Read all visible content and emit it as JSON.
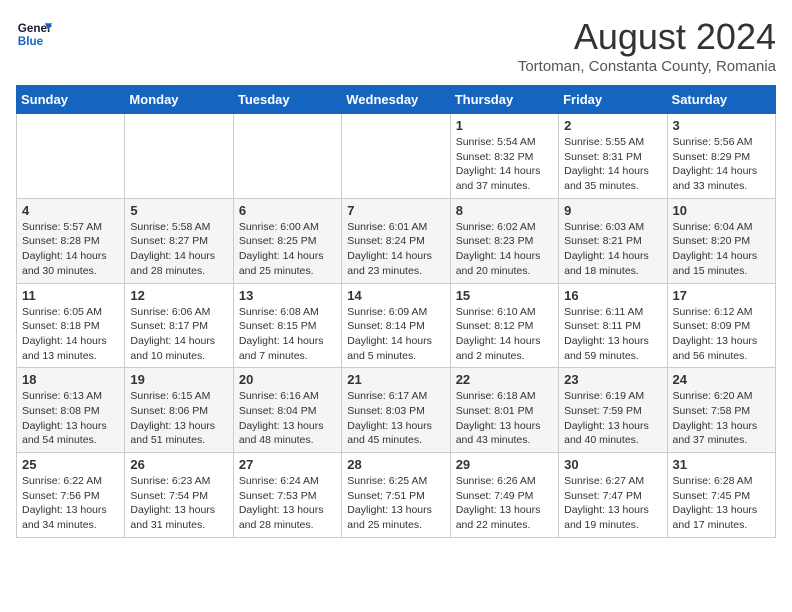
{
  "logo": {
    "line1": "General",
    "line2": "Blue"
  },
  "title": "August 2024",
  "subtitle": "Tortoman, Constanta County, Romania",
  "days_header": [
    "Sunday",
    "Monday",
    "Tuesday",
    "Wednesday",
    "Thursday",
    "Friday",
    "Saturday"
  ],
  "weeks": [
    [
      {
        "date": "",
        "detail": ""
      },
      {
        "date": "",
        "detail": ""
      },
      {
        "date": "",
        "detail": ""
      },
      {
        "date": "",
        "detail": ""
      },
      {
        "date": "1",
        "detail": "Sunrise: 5:54 AM\nSunset: 8:32 PM\nDaylight: 14 hours\nand 37 minutes."
      },
      {
        "date": "2",
        "detail": "Sunrise: 5:55 AM\nSunset: 8:31 PM\nDaylight: 14 hours\nand 35 minutes."
      },
      {
        "date": "3",
        "detail": "Sunrise: 5:56 AM\nSunset: 8:29 PM\nDaylight: 14 hours\nand 33 minutes."
      }
    ],
    [
      {
        "date": "4",
        "detail": "Sunrise: 5:57 AM\nSunset: 8:28 PM\nDaylight: 14 hours\nand 30 minutes."
      },
      {
        "date": "5",
        "detail": "Sunrise: 5:58 AM\nSunset: 8:27 PM\nDaylight: 14 hours\nand 28 minutes."
      },
      {
        "date": "6",
        "detail": "Sunrise: 6:00 AM\nSunset: 8:25 PM\nDaylight: 14 hours\nand 25 minutes."
      },
      {
        "date": "7",
        "detail": "Sunrise: 6:01 AM\nSunset: 8:24 PM\nDaylight: 14 hours\nand 23 minutes."
      },
      {
        "date": "8",
        "detail": "Sunrise: 6:02 AM\nSunset: 8:23 PM\nDaylight: 14 hours\nand 20 minutes."
      },
      {
        "date": "9",
        "detail": "Sunrise: 6:03 AM\nSunset: 8:21 PM\nDaylight: 14 hours\nand 18 minutes."
      },
      {
        "date": "10",
        "detail": "Sunrise: 6:04 AM\nSunset: 8:20 PM\nDaylight: 14 hours\nand 15 minutes."
      }
    ],
    [
      {
        "date": "11",
        "detail": "Sunrise: 6:05 AM\nSunset: 8:18 PM\nDaylight: 14 hours\nand 13 minutes."
      },
      {
        "date": "12",
        "detail": "Sunrise: 6:06 AM\nSunset: 8:17 PM\nDaylight: 14 hours\nand 10 minutes."
      },
      {
        "date": "13",
        "detail": "Sunrise: 6:08 AM\nSunset: 8:15 PM\nDaylight: 14 hours\nand 7 minutes."
      },
      {
        "date": "14",
        "detail": "Sunrise: 6:09 AM\nSunset: 8:14 PM\nDaylight: 14 hours\nand 5 minutes."
      },
      {
        "date": "15",
        "detail": "Sunrise: 6:10 AM\nSunset: 8:12 PM\nDaylight: 14 hours\nand 2 minutes."
      },
      {
        "date": "16",
        "detail": "Sunrise: 6:11 AM\nSunset: 8:11 PM\nDaylight: 13 hours\nand 59 minutes."
      },
      {
        "date": "17",
        "detail": "Sunrise: 6:12 AM\nSunset: 8:09 PM\nDaylight: 13 hours\nand 56 minutes."
      }
    ],
    [
      {
        "date": "18",
        "detail": "Sunrise: 6:13 AM\nSunset: 8:08 PM\nDaylight: 13 hours\nand 54 minutes."
      },
      {
        "date": "19",
        "detail": "Sunrise: 6:15 AM\nSunset: 8:06 PM\nDaylight: 13 hours\nand 51 minutes."
      },
      {
        "date": "20",
        "detail": "Sunrise: 6:16 AM\nSunset: 8:04 PM\nDaylight: 13 hours\nand 48 minutes."
      },
      {
        "date": "21",
        "detail": "Sunrise: 6:17 AM\nSunset: 8:03 PM\nDaylight: 13 hours\nand 45 minutes."
      },
      {
        "date": "22",
        "detail": "Sunrise: 6:18 AM\nSunset: 8:01 PM\nDaylight: 13 hours\nand 43 minutes."
      },
      {
        "date": "23",
        "detail": "Sunrise: 6:19 AM\nSunset: 7:59 PM\nDaylight: 13 hours\nand 40 minutes."
      },
      {
        "date": "24",
        "detail": "Sunrise: 6:20 AM\nSunset: 7:58 PM\nDaylight: 13 hours\nand 37 minutes."
      }
    ],
    [
      {
        "date": "25",
        "detail": "Sunrise: 6:22 AM\nSunset: 7:56 PM\nDaylight: 13 hours\nand 34 minutes."
      },
      {
        "date": "26",
        "detail": "Sunrise: 6:23 AM\nSunset: 7:54 PM\nDaylight: 13 hours\nand 31 minutes."
      },
      {
        "date": "27",
        "detail": "Sunrise: 6:24 AM\nSunset: 7:53 PM\nDaylight: 13 hours\nand 28 minutes."
      },
      {
        "date": "28",
        "detail": "Sunrise: 6:25 AM\nSunset: 7:51 PM\nDaylight: 13 hours\nand 25 minutes."
      },
      {
        "date": "29",
        "detail": "Sunrise: 6:26 AM\nSunset: 7:49 PM\nDaylight: 13 hours\nand 22 minutes."
      },
      {
        "date": "30",
        "detail": "Sunrise: 6:27 AM\nSunset: 7:47 PM\nDaylight: 13 hours\nand 19 minutes."
      },
      {
        "date": "31",
        "detail": "Sunrise: 6:28 AM\nSunset: 7:45 PM\nDaylight: 13 hours\nand 17 minutes."
      }
    ]
  ]
}
